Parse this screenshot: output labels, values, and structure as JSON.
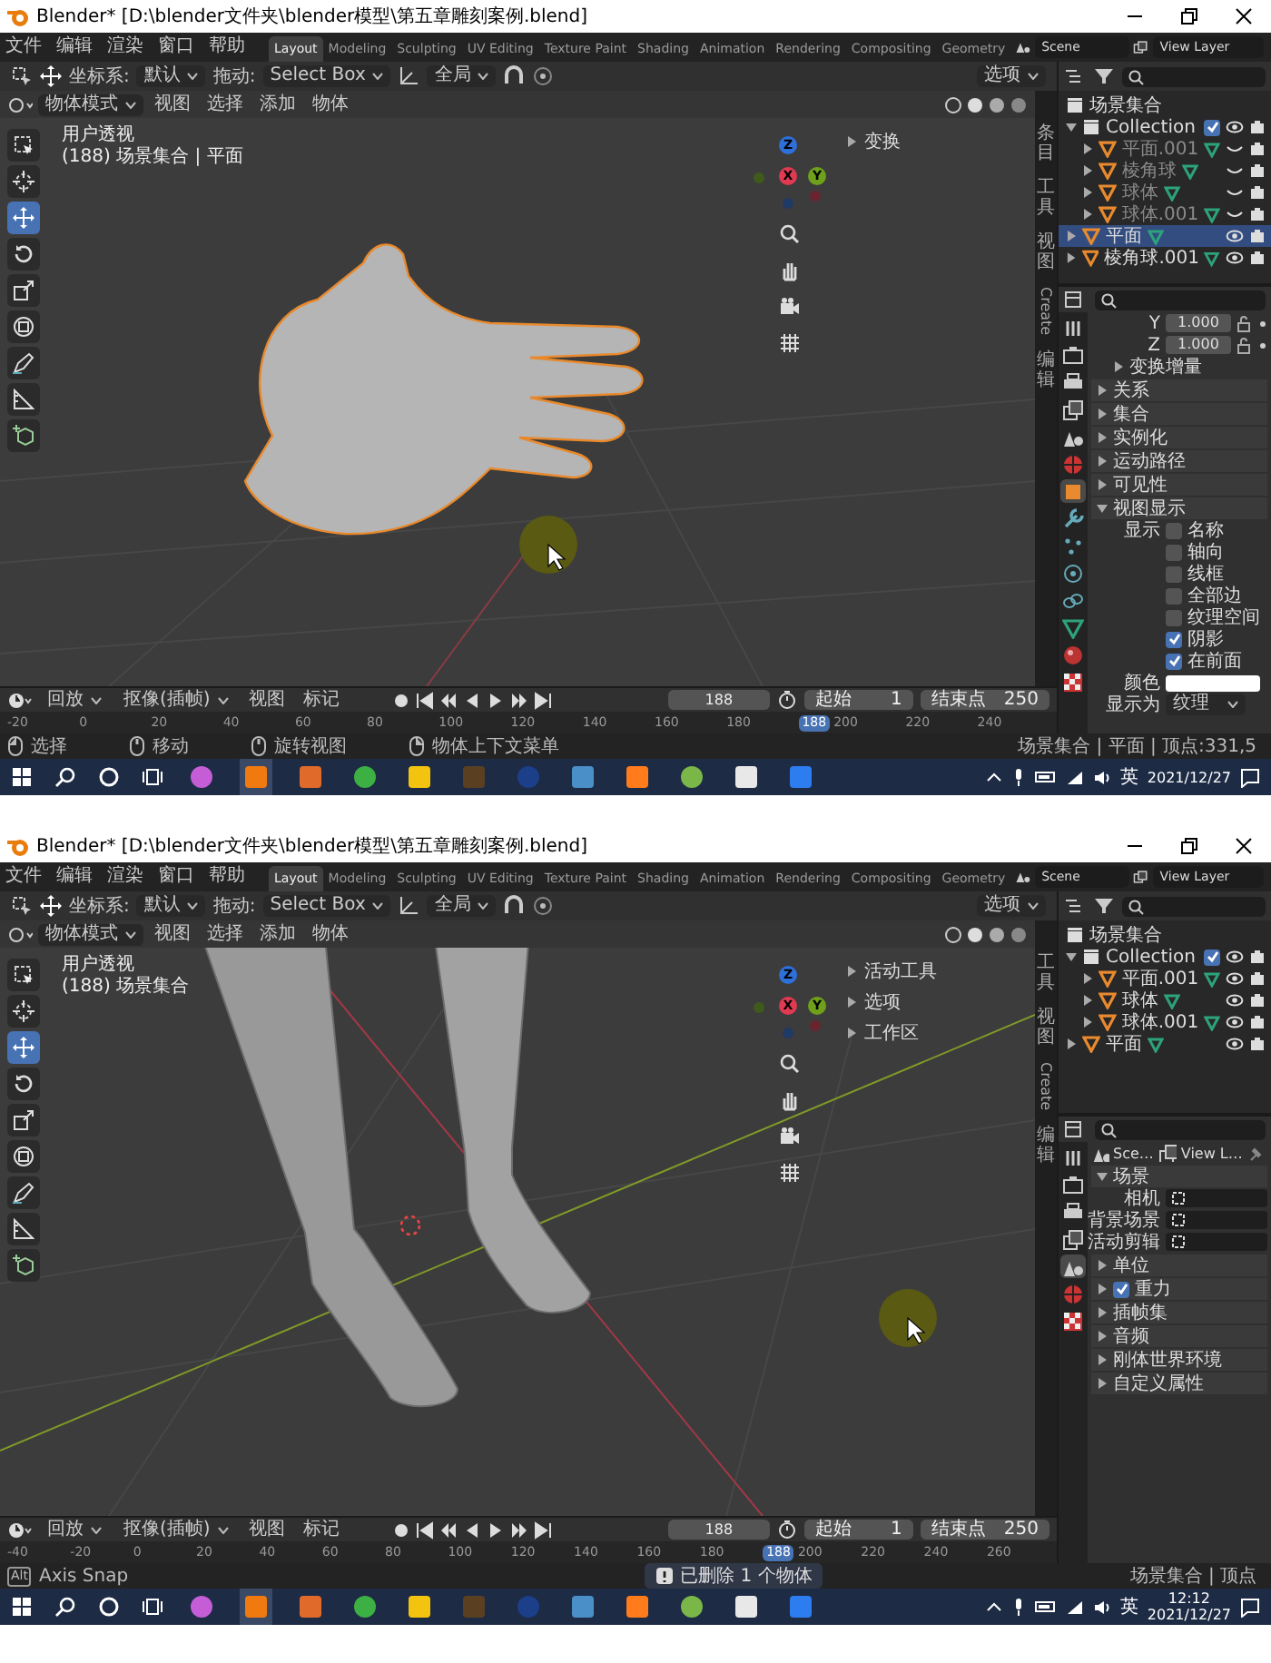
{
  "shots": [
    {
      "title": "Blender* [D:\\blender文件夹\\blender模型\\第五章雕刻案例.blend]",
      "menu": [
        "文件",
        "编辑",
        "渲染",
        "窗口",
        "帮助"
      ],
      "workspaces": [
        {
          "label": "Layout",
          "selected": true
        },
        {
          "label": "Modeling",
          "selected": false
        },
        {
          "label": "Sculpting",
          "selected": false
        },
        {
          "label": "UV Editing",
          "selected": false
        },
        {
          "label": "Texture Paint",
          "selected": false
        },
        {
          "label": "Shading",
          "selected": false
        },
        {
          "label": "Animation",
          "selected": false
        },
        {
          "label": "Rendering",
          "selected": false
        },
        {
          "label": "Compositing",
          "selected": false
        },
        {
          "label": "Geometry",
          "selected": false
        }
      ],
      "scene": "Scene",
      "view_layer": "View Layer",
      "tool_header": {
        "coord_label": "坐标系:",
        "coord_value": "默认",
        "drag_label": "拖动:",
        "drag_value": "Select Box",
        "pivot_value": "全局",
        "options": "选项"
      },
      "viewport": {
        "mode": "物体模式",
        "menus": [
          "视图",
          "选择",
          "添加",
          "物体"
        ],
        "view_name": "用户透视",
        "info": "(188) 场景集合 | 平面",
        "kind": "hand",
        "tools": [
          {
            "kind": "select",
            "selected": false
          },
          {
            "kind": "cursor",
            "selected": false
          },
          {
            "kind": "move",
            "selected": true
          },
          {
            "kind": "rotate",
            "selected": false
          },
          {
            "kind": "scale",
            "selected": false
          },
          {
            "kind": "transform",
            "selected": false
          },
          {
            "kind": "annotate",
            "selected": false
          },
          {
            "kind": "measure",
            "selected": false
          },
          {
            "kind": "add",
            "selected": false
          }
        ],
        "gizmo": [
          {
            "label": "Z",
            "color": "#2e6fd8"
          },
          {
            "label": "X",
            "color": "#e03a52"
          },
          {
            "label": "Y",
            "color": "#6fa01c"
          }
        ],
        "panel_items": [
          {
            "label": "变换",
            "expanded": false
          }
        ],
        "side_tabs": [
          {
            "label": "条目",
            "kind": "stacked"
          },
          {
            "label": "工具",
            "kind": "stacked"
          },
          {
            "label": "视图",
            "kind": "stacked"
          },
          {
            "label": "Create",
            "kind": "rotated"
          },
          {
            "label": "编辑",
            "kind": "stacked"
          }
        ]
      },
      "outliner": {
        "title": "场景集合",
        "items": [
          {
            "kind": "collection",
            "label": "Collection",
            "checked": true,
            "visible": true,
            "selected": false,
            "children": [
              {
                "kind": "object",
                "label": "平面.001",
                "visible": false,
                "selected": false
              },
              {
                "kind": "object",
                "label": "棱角球",
                "visible": false,
                "selected": false
              },
              {
                "kind": "object",
                "label": "球体",
                "visible": false,
                "selected": false
              },
              {
                "kind": "object",
                "label": "球体.001",
                "visible": false,
                "selected": false
              }
            ]
          },
          {
            "kind": "object",
            "label": "平面",
            "visible": true,
            "selected": true
          },
          {
            "kind": "object",
            "label": "棱角球.001",
            "visible": true,
            "selected": false
          }
        ]
      },
      "properties": {
        "tabs": [
          {
            "kind": "tool",
            "selected": false
          },
          {
            "kind": "render",
            "selected": false
          },
          {
            "kind": "output",
            "selected": false
          },
          {
            "kind": "view",
            "selected": false
          },
          {
            "kind": "scene",
            "selected": false
          },
          {
            "kind": "world",
            "selected": false
          },
          {
            "kind": "object",
            "selected": true
          },
          {
            "kind": "modifier",
            "selected": false
          },
          {
            "kind": "particles",
            "selected": false
          },
          {
            "kind": "physics",
            "selected": false
          },
          {
            "kind": "constraints",
            "selected": false
          },
          {
            "kind": "data",
            "selected": false
          },
          {
            "kind": "material",
            "selected": false
          },
          {
            "kind": "texture",
            "selected": false
          }
        ],
        "rows": [
          {
            "kind": "number",
            "label": "Y",
            "value": "1.000"
          },
          {
            "kind": "number",
            "label": "Z",
            "value": "1.000"
          },
          {
            "kind": "subsection",
            "label": "变换增量",
            "expanded": false
          },
          {
            "kind": "section",
            "label": "关系",
            "expanded": false
          },
          {
            "kind": "section",
            "label": "集合",
            "expanded": false
          },
          {
            "kind": "section",
            "label": "实例化",
            "expanded": false
          },
          {
            "kind": "section",
            "label": "运动路径",
            "expanded": false
          },
          {
            "kind": "section",
            "label": "可见性",
            "expanded": false
          },
          {
            "kind": "section",
            "label": "视图显示",
            "expanded": true,
            "children": [
              {
                "kind": "check",
                "group": "显示",
                "label": "名称",
                "checked": false
              },
              {
                "kind": "check",
                "label": "轴向",
                "checked": false
              },
              {
                "kind": "check",
                "label": "线框",
                "checked": false
              },
              {
                "kind": "check",
                "label": "全部边",
                "checked": false
              },
              {
                "kind": "check",
                "label": "纹理空间",
                "checked": false
              },
              {
                "kind": "check",
                "label": "阴影",
                "checked": true
              },
              {
                "kind": "check",
                "label": "在前面",
                "checked": true
              },
              {
                "kind": "color",
                "label": "颜色"
              },
              {
                "kind": "select",
                "label": "显示为",
                "value": "纹理"
              }
            ]
          }
        ]
      },
      "timeline": {
        "menus": [
          {
            "label": "回放",
            "kind": "dropdown"
          },
          {
            "label": "抠像(插帧)",
            "kind": "dropdown"
          },
          {
            "label": "视图",
            "kind": "menu"
          },
          {
            "label": "标记",
            "kind": "menu"
          }
        ],
        "frame": "188",
        "start_label": "起始",
        "start": "1",
        "end_label": "结束点",
        "end": "250",
        "ruler": [
          {
            "kind": "tick",
            "label": "-20"
          },
          {
            "kind": "tick",
            "label": "0"
          },
          {
            "kind": "tick",
            "label": "20"
          },
          {
            "kind": "tick",
            "label": "40"
          },
          {
            "kind": "tick",
            "label": "60"
          },
          {
            "kind": "tick",
            "label": "80"
          },
          {
            "kind": "tick",
            "label": "100"
          },
          {
            "kind": "tick",
            "label": "120"
          },
          {
            "kind": "tick",
            "label": "140"
          },
          {
            "kind": "tick",
            "label": "160"
          },
          {
            "kind": "tick",
            "label": "180"
          },
          {
            "kind": "current",
            "label": "188"
          },
          {
            "kind": "tick",
            "label": "200"
          },
          {
            "kind": "tick",
            "label": "220"
          },
          {
            "kind": "tick",
            "label": "240"
          }
        ]
      },
      "status": {
        "items": [
          {
            "kind": "mouse_left",
            "label": "选择"
          },
          {
            "kind": "mouse_middle",
            "label": "移动"
          },
          {
            "kind": "mouse_middle",
            "label": "旋转视图"
          },
          {
            "kind": "mouse_right",
            "label": "物体上下文菜单"
          }
        ],
        "stats": "场景集合 | 平面 | 顶点:331,5"
      },
      "taskbar": {
        "lang": "英",
        "date": "2021/12/27"
      }
    },
    {
      "title": "Blender* [D:\\blender文件夹\\blender模型\\第五章雕刻案例.blend]",
      "menu": [
        "文件",
        "编辑",
        "渲染",
        "窗口",
        "帮助"
      ],
      "workspaces": [
        {
          "label": "Layout",
          "selected": true
        },
        {
          "label": "Modeling",
          "selected": false
        },
        {
          "label": "Sculpting",
          "selected": false
        },
        {
          "label": "UV Editing",
          "selected": false
        },
        {
          "label": "Texture Paint",
          "selected": false
        },
        {
          "label": "Shading",
          "selected": false
        },
        {
          "label": "Animation",
          "selected": false
        },
        {
          "label": "Rendering",
          "selected": false
        },
        {
          "label": "Compositing",
          "selected": false
        },
        {
          "label": "Geometry",
          "selected": false
        }
      ],
      "scene": "Scene",
      "view_layer": "View Layer",
      "tool_header": {
        "coord_label": "坐标系:",
        "coord_value": "默认",
        "drag_label": "拖动:",
        "drag_value": "Select Box",
        "pivot_value": "全局",
        "options": "选项"
      },
      "viewport": {
        "mode": "物体模式",
        "menus": [
          "视图",
          "选择",
          "添加",
          "物体"
        ],
        "view_name": "用户透视",
        "info": "(188) 场景集合",
        "kind": "legs",
        "tools": [
          {
            "kind": "select",
            "selected": false
          },
          {
            "kind": "cursor",
            "selected": false
          },
          {
            "kind": "move",
            "selected": true
          },
          {
            "kind": "rotate",
            "selected": false
          },
          {
            "kind": "scale",
            "selected": false
          },
          {
            "kind": "transform",
            "selected": false
          },
          {
            "kind": "annotate",
            "selected": false
          },
          {
            "kind": "measure",
            "selected": false
          },
          {
            "kind": "add",
            "selected": false
          }
        ],
        "gizmo": [
          {
            "label": "Z",
            "color": "#2e6fd8"
          },
          {
            "label": "X",
            "color": "#e03a52"
          },
          {
            "label": "Y",
            "color": "#6fa01c"
          }
        ],
        "panel_items": [
          {
            "label": "活动工具",
            "expanded": false
          },
          {
            "label": "选项",
            "expanded": false
          },
          {
            "label": "工作区",
            "expanded": false
          }
        ],
        "side_tabs": [
          {
            "label": "工具",
            "kind": "stacked"
          },
          {
            "label": "视图",
            "kind": "stacked"
          },
          {
            "label": "Create",
            "kind": "rotated"
          },
          {
            "label": "编辑",
            "kind": "stacked"
          }
        ]
      },
      "outliner": {
        "title": "场景集合",
        "items": [
          {
            "kind": "collection",
            "label": "Collection",
            "checked": true,
            "visible": true,
            "selected": false,
            "children": [
              {
                "kind": "object",
                "label": "平面.001",
                "visible": true,
                "selected": false
              },
              {
                "kind": "object",
                "label": "球体",
                "visible": true,
                "selected": false
              },
              {
                "kind": "object",
                "label": "球体.001",
                "visible": true,
                "selected": false
              }
            ]
          },
          {
            "kind": "object",
            "label": "平面",
            "visible": true,
            "selected": false
          }
        ]
      },
      "properties": {
        "tabs": [
          {
            "kind": "tool",
            "selected": false
          },
          {
            "kind": "render",
            "selected": false
          },
          {
            "kind": "output",
            "selected": false
          },
          {
            "kind": "view",
            "selected": false
          },
          {
            "kind": "scene",
            "selected": true
          },
          {
            "kind": "world",
            "selected": false
          },
          {
            "kind": "texture",
            "selected": false
          }
        ],
        "rows": [
          {
            "kind": "pickers",
            "items": [
              "Sce…",
              "View L…"
            ]
          },
          {
            "kind": "section",
            "label": "场景",
            "expanded": true,
            "children": [
              {
                "kind": "field",
                "label": "相机"
              },
              {
                "kind": "field",
                "label": "背景场景"
              },
              {
                "kind": "field",
                "label": "活动剪辑"
              }
            ]
          },
          {
            "kind": "section",
            "label": "单位",
            "expanded": false
          },
          {
            "kind": "check_section",
            "label": "重力",
            "expanded": false,
            "checked": true
          },
          {
            "kind": "section",
            "label": "插帧集",
            "expanded": false
          },
          {
            "kind": "section",
            "label": "音频",
            "expanded": false
          },
          {
            "kind": "section",
            "label": "刚体世界环境",
            "expanded": false
          },
          {
            "kind": "section",
            "label": "自定义属性",
            "expanded": false
          }
        ]
      },
      "timeline": {
        "menus": [
          {
            "label": "回放",
            "kind": "dropdown"
          },
          {
            "label": "抠像(插帧)",
            "kind": "dropdown"
          },
          {
            "label": "视图",
            "kind": "menu"
          },
          {
            "label": "标记",
            "kind": "menu"
          }
        ],
        "frame": "188",
        "start_label": "起始",
        "start": "1",
        "end_label": "结束点",
        "end": "250",
        "ruler": [
          {
            "kind": "tick",
            "label": "-40"
          },
          {
            "kind": "tick",
            "label": "-20"
          },
          {
            "kind": "tick",
            "label": "0"
          },
          {
            "kind": "tick",
            "label": "20"
          },
          {
            "kind": "tick",
            "label": "40"
          },
          {
            "kind": "tick",
            "label": "60"
          },
          {
            "kind": "tick",
            "label": "80"
          },
          {
            "kind": "tick",
            "label": "100"
          },
          {
            "kind": "tick",
            "label": "120"
          },
          {
            "kind": "tick",
            "label": "140"
          },
          {
            "kind": "tick",
            "label": "160"
          },
          {
            "kind": "tick",
            "label": "180"
          },
          {
            "kind": "current",
            "label": "188"
          },
          {
            "kind": "tick",
            "label": "200"
          },
          {
            "kind": "tick",
            "label": "220"
          },
          {
            "kind": "tick",
            "label": "240"
          },
          {
            "kind": "tick",
            "label": "260"
          }
        ]
      },
      "status": {
        "items": [
          {
            "kind": "key",
            "key": "Alt",
            "label": "Axis Snap"
          }
        ],
        "message": "已删除 1 个物体",
        "stats": "场景集合 | 顶点"
      },
      "taskbar": {
        "lang": "英",
        "time": "12:12",
        "date": "2021/12/27"
      }
    }
  ]
}
